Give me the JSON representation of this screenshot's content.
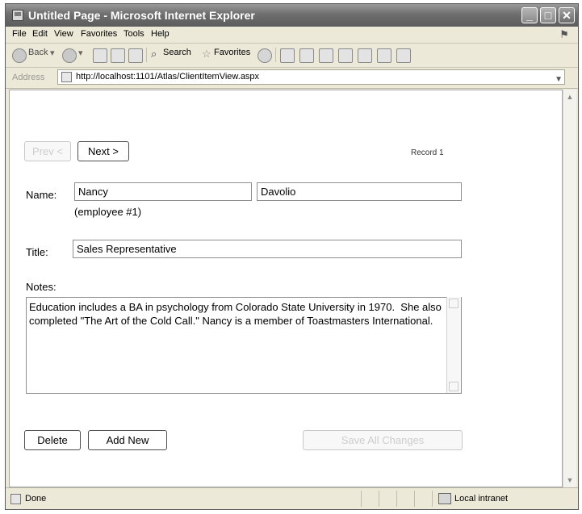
{
  "window": {
    "title": "Untitled Page - Microsoft Internet Explorer"
  },
  "menu": [
    "File",
    "Edit",
    "View",
    "Favorites",
    "Tools",
    "Help"
  ],
  "toolbar": {
    "back": "Back",
    "search": "Search",
    "favorites": "Favorites"
  },
  "address": {
    "label": "Address",
    "url": "http://localhost:1101/Atlas/ClientItemView.aspx"
  },
  "form": {
    "prev_label": "Prev <",
    "next_label": "Next >",
    "record_label": "Record 1",
    "name_label": "Name:",
    "first_name": "Nancy",
    "last_name": "Davolio",
    "employee_id": "(employee #1)",
    "title_label": "Title:",
    "title_value": "Sales Representative",
    "notes_label": "Notes:",
    "notes_value": "Education includes a BA in psychology from Colorado State University in 1970.  She also completed \"The Art of the Cold Call.\" Nancy is a member of Toastmasters International.",
    "delete_label": "Delete",
    "add_new_label": "Add New",
    "save_all_label": "Save All Changes"
  },
  "status": {
    "text": "Done",
    "zone": "Local intranet"
  }
}
